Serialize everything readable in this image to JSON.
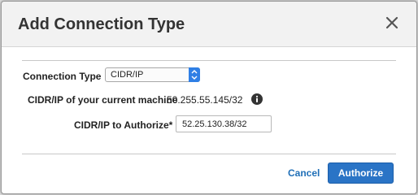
{
  "dialog": {
    "title": "Add Connection Type",
    "close_icon": "close-icon"
  },
  "form": {
    "connection_type": {
      "label": "Connection Type",
      "selected": "CIDR/IP"
    },
    "current_machine": {
      "label": "CIDR/IP of your current machine",
      "value": "50.255.55.145/32",
      "icon": "info-icon"
    },
    "authorize_cidr": {
      "label": "CIDR/IP to Authorize*",
      "value": "52.25.130.38/32"
    }
  },
  "footer": {
    "cancel_label": "Cancel",
    "authorize_label": "Authorize"
  },
  "colors": {
    "accent": "#2a74c6",
    "link": "#1f6fb7",
    "header_bg": "#f2f2f2"
  }
}
